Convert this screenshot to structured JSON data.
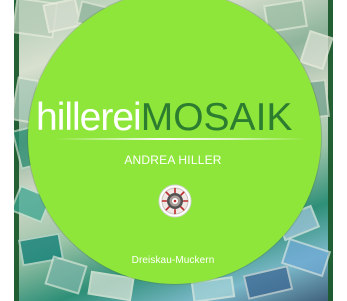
{
  "logo": {
    "brand_primary": "hillerei",
    "brand_secondary": "MOSAIK",
    "owner": "ANDREA HILLER",
    "location": "Dreiskau-Muckern",
    "colors": {
      "disc_green": "#8ee63b",
      "mosaik_green": "#2c7d2f",
      "text_white": "#ffffff",
      "frame_green": "#1c5a2d"
    },
    "emblem_icon": "round-mosaic-emblem-icon"
  }
}
